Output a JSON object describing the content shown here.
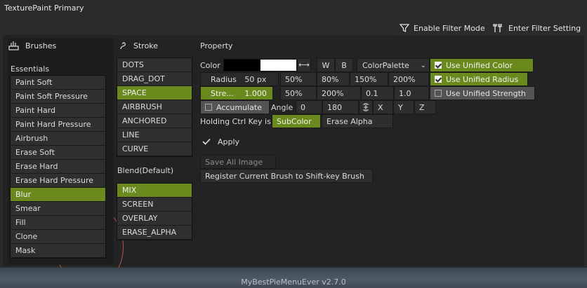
{
  "app": {
    "title": "TexturePaint Primary",
    "footer": "MyBestPieMenuEver v2.7.0"
  },
  "toolbar": {
    "filter_mode": "Enable Filter Mode",
    "filter_setting": "Enter Filter Setting"
  },
  "brushes": {
    "header": "Brushes",
    "group": "Essentials",
    "items": [
      {
        "label": "Paint Soft"
      },
      {
        "label": "Paint Soft Pressure"
      },
      {
        "label": "Paint Hard"
      },
      {
        "label": "Paint Hard Pressure"
      },
      {
        "label": "Airbrush"
      },
      {
        "label": "Erase Soft"
      },
      {
        "label": "Erase Hard"
      },
      {
        "label": "Erase Hard Pressure"
      },
      {
        "label": "Blur"
      },
      {
        "label": "Smear"
      },
      {
        "label": "Fill"
      },
      {
        "label": "Clone"
      },
      {
        "label": "Mask"
      }
    ],
    "selected": "Blur"
  },
  "stroke": {
    "header": "Stroke",
    "items": [
      {
        "label": "DOTS"
      },
      {
        "label": "DRAG_DOT"
      },
      {
        "label": "SPACE"
      },
      {
        "label": "AIRBRUSH"
      },
      {
        "label": "ANCHORED"
      },
      {
        "label": "LINE"
      },
      {
        "label": "CURVE"
      }
    ],
    "selected": "SPACE"
  },
  "blend": {
    "header": "Blend(Default)",
    "items": [
      {
        "label": "MIX"
      },
      {
        "label": "SCREEN"
      },
      {
        "label": "OVERLAY"
      },
      {
        "label": "ERASE_ALPHA"
      }
    ],
    "selected": "MIX"
  },
  "property": {
    "header": "Property",
    "color_label": "Color",
    "primary_color": "#000000",
    "secondary_color": "#ffffff",
    "w_label": "W",
    "b_label": "B",
    "palette_label": "ColorPalette",
    "use_unified_color": "Use Unified Color",
    "radius_label": "Radius",
    "radius_value": "50 px",
    "radius_presets": [
      "50%",
      "80%",
      "150%",
      "200%"
    ],
    "use_unified_radius": "Use Unified Radius",
    "strength_label": "Stre...",
    "strength_value": "1.000",
    "strength_presets": [
      "50%",
      "200%",
      "0.1",
      "1.0"
    ],
    "use_unified_strength": "Use Unified Strength",
    "accumulate_label": "Accumulate",
    "angle_label": "Angle",
    "angle_values": [
      "0",
      "180"
    ],
    "axes": [
      "X",
      "Y",
      "Z"
    ],
    "ctrl_label": "Holding Ctrl Key is",
    "ctrl_options": [
      "SubColor",
      "Erase Alpha"
    ],
    "apply_label": "Apply",
    "save_all_label": "Save All Image",
    "register_label": "Register Current Brush to Shift-key Brush"
  },
  "colors": {
    "accent": "#6a8a1e",
    "panel": "#232323",
    "item": "#2f2f2f"
  }
}
